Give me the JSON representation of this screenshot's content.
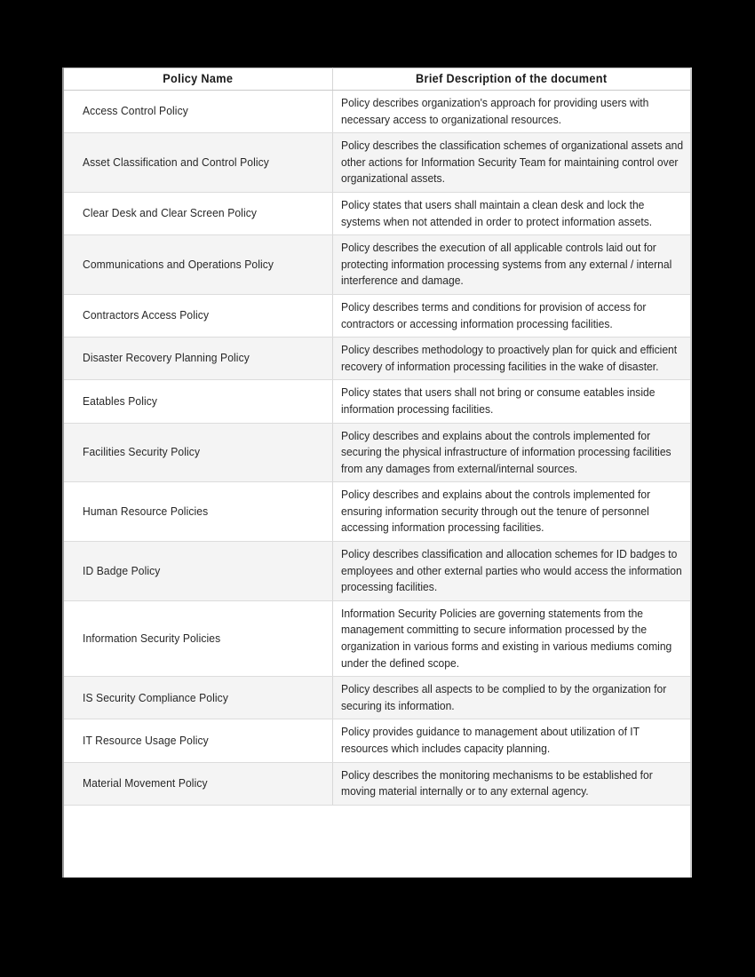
{
  "page": {
    "background_color": "#000000",
    "table_background": "#ffffff",
    "row_shaded_color": "#f4f4f4",
    "text_color": "#272727"
  },
  "table": {
    "columns": [
      {
        "key": "policy_name",
        "label": "Policy Name"
      },
      {
        "key": "description",
        "label": "Brief Description of the document"
      }
    ],
    "rows": [
      {
        "policy_name": "Access Control Policy",
        "description": "Policy describes organization's approach for providing users with necessary access to organizational resources."
      },
      {
        "policy_name": "Asset Classification and Control Policy",
        "description": "Policy describes the classification schemes of organizational assets and other actions for Information Security Team for maintaining control over organizational assets."
      },
      {
        "policy_name": "Clear Desk and Clear Screen Policy",
        "description": "Policy states that users shall maintain a clean desk and lock the systems when not attended in order to protect information assets."
      },
      {
        "policy_name": "Communications and Operations Policy",
        "description": "Policy describes the execution of all applicable controls laid out for protecting information processing systems from any external / internal interference and damage."
      },
      {
        "policy_name": "Contractors Access Policy",
        "description": "Policy describes terms and conditions for provision of access for contractors or accessing information processing facilities."
      },
      {
        "policy_name": "Disaster Recovery Planning Policy",
        "description": "Policy describes methodology to proactively plan for quick and efficient recovery of information processing facilities in the wake of disaster."
      },
      {
        "policy_name": "Eatables Policy",
        "description": "Policy states that users shall not bring or consume eatables inside information processing facilities."
      },
      {
        "policy_name": "Facilities Security Policy",
        "description": "Policy describes and explains about the controls implemented for securing the physical infrastructure of information processing facilities from any damages from external/internal sources."
      },
      {
        "policy_name": "Human Resource Policies",
        "description": "Policy describes and explains about the controls implemented for ensuring information security through out the tenure of personnel accessing information processing facilities."
      },
      {
        "policy_name": "ID Badge Policy",
        "description": "Policy describes classification and allocation schemes for ID badges to employees and other external parties who would access the information processing facilities."
      },
      {
        "policy_name": "Information Security Policies",
        "description": "Information Security Policies are governing statements from the management committing to secure information processed by the organization in various forms and existing in various mediums coming under the defined scope."
      },
      {
        "policy_name": "IS Security Compliance Policy",
        "description": "Policy describes all aspects to be complied to by the organization for securing its information."
      },
      {
        "policy_name": "IT Resource Usage Policy",
        "description": "Policy provides guidance to management about utilization of IT resources which includes capacity planning."
      },
      {
        "policy_name": "Material Movement Policy",
        "description": "Policy describes the monitoring mechanisms to be established for moving material internally or to any external agency."
      }
    ]
  }
}
